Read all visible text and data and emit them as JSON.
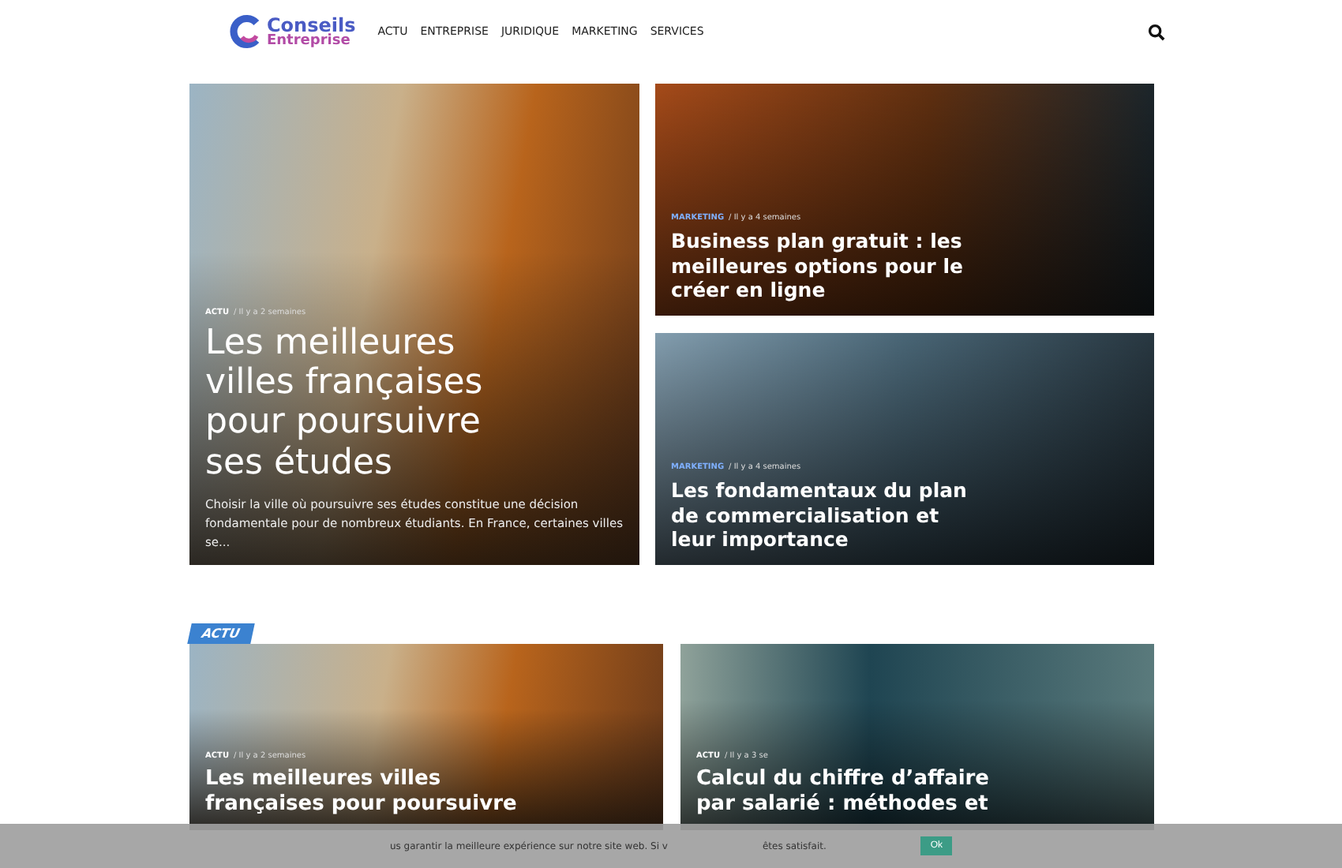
{
  "header": {
    "logo": {
      "line1": "Conseils",
      "line2": "Entreprise"
    },
    "nav": [
      {
        "label": "ACTU"
      },
      {
        "label": "ENTREPRISE"
      },
      {
        "label": "JURIDIQUE"
      },
      {
        "label": "MARKETING"
      },
      {
        "label": "SERVICES"
      }
    ]
  },
  "featured": [
    {
      "category": "ACTU",
      "date": "/ Il y a 2 semaines",
      "title": "Les meilleures villes françaises pour poursuivre ses études",
      "excerpt": "Choisir la ville où poursuivre ses études constitue une décision fondamentale pour de nombreux étudiants. En France, certaines villes se..."
    },
    {
      "category": "MARKETING",
      "date": "/ Il y a 4 semaines",
      "title": "Business plan gratuit : les meilleures options pour le créer en ligne"
    },
    {
      "category": "MARKETING",
      "date": "/ Il y a 4 semaines",
      "title": "Les fondamentaux du plan de commercialisation et leur importance"
    }
  ],
  "section": {
    "badge": "ACTU",
    "cards": [
      {
        "category": "ACTU",
        "date": "/ Il y a 2 semaines",
        "title": "Les meilleures villes françaises pour poursuivre"
      },
      {
        "category": "ACTU",
        "date": "/ Il y a 3 se",
        "title": "Calcul du chiffre d’affaire par salarié : méthodes et"
      }
    ]
  },
  "cookie": {
    "text": "us garantir la meilleure expérience sur notre site web. Si v",
    "text_end": "êtes satisfait.",
    "button": "Ok"
  }
}
